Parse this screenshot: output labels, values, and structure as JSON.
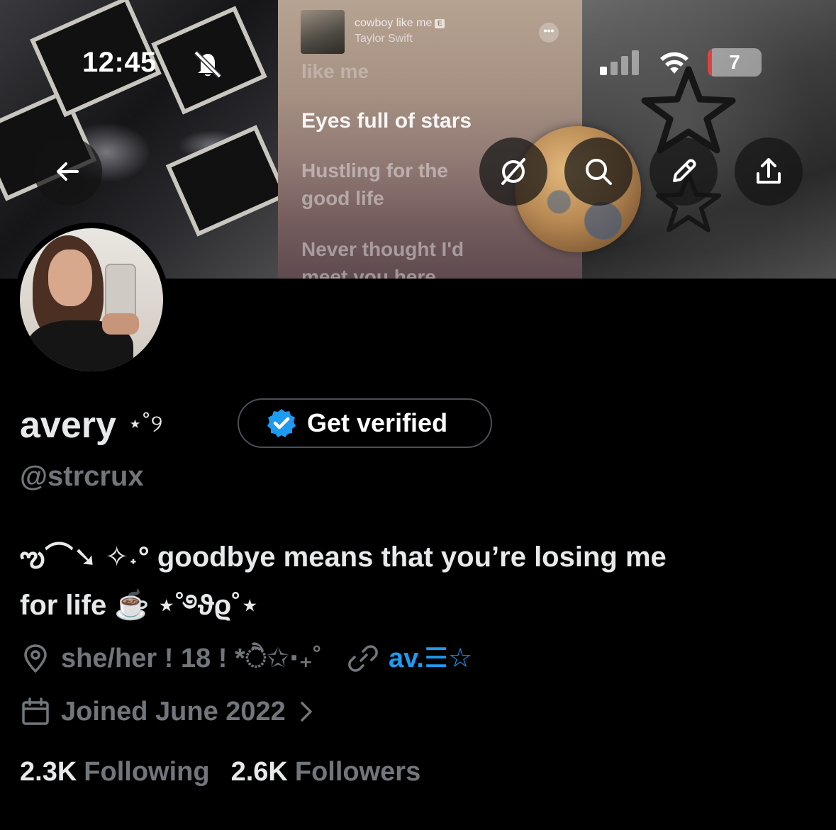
{
  "status_bar": {
    "time": "12:45",
    "battery_level": "7",
    "battery_fraction": 0.07
  },
  "header": {
    "now_playing": {
      "song": "cowboy like me",
      "explicit_badge": "E",
      "artist": "Taylor Swift",
      "more_label": "•••"
    },
    "lyrics": [
      "like me",
      "Eyes full of stars",
      "Hustling for the",
      "good life",
      "Never thought I'd",
      "meet you here"
    ],
    "buttons": [
      "back",
      "grok",
      "search",
      "edit",
      "share"
    ]
  },
  "profile": {
    "display_name": "avery",
    "name_decoration": "⋆˚୨",
    "verify_label": "Get verified",
    "handle": "@strcrux",
    "bio_line1": "ఌ︎⌒➘ ✧˖° goodbye means that you’re losing me",
    "bio_line2": "for life ☕️ ⋆˚࿔ϑϱ˚⋆",
    "location": "she/her ! 18 ! *ੈ✩‧₊˚",
    "website": "av.☰☆",
    "joined": "Joined June 2022",
    "following_count": "2.3K",
    "following_label": "Following",
    "followers_count": "2.6K",
    "followers_label": "Followers"
  },
  "colors": {
    "background": "#000000",
    "primary_text": "#e7e9ea",
    "secondary_text": "#71767b",
    "link": "#1d9bf0",
    "verified_badge": "#1d9bf0",
    "battery_low": "#e0423f"
  },
  "icons": {
    "status": [
      "bell-slash-icon",
      "signal-icon",
      "wifi-icon",
      "battery-icon"
    ],
    "header": [
      "arrow-left-icon",
      "grok-icon",
      "search-icon",
      "pencil-icon",
      "share-icon"
    ],
    "meta": [
      "location-pin-icon",
      "link-icon",
      "calendar-icon",
      "chevron-right-icon"
    ],
    "badge": "verified-badge-icon"
  }
}
